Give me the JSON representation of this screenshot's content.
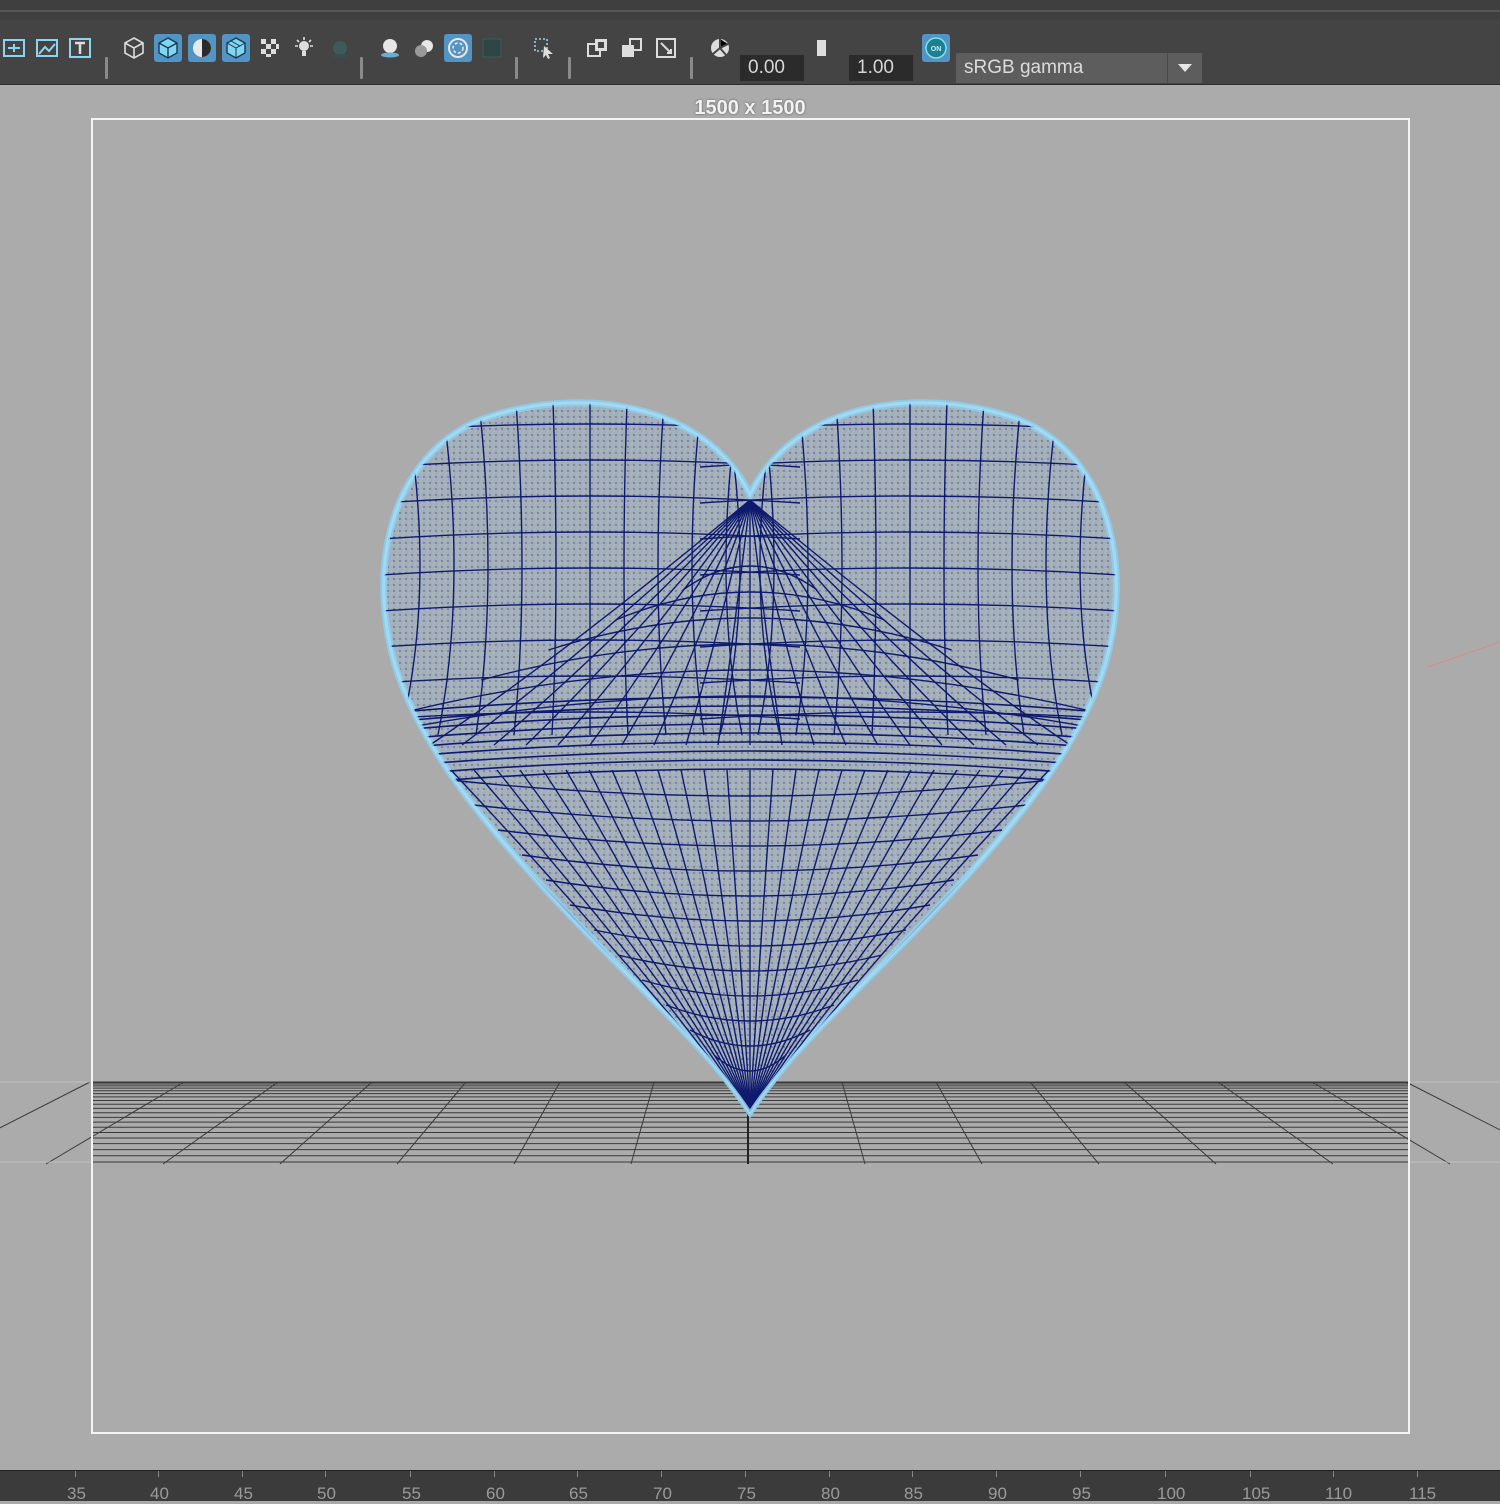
{
  "toolbar": {
    "icons": [
      {
        "name": "frame-all-icon",
        "active": false
      },
      {
        "name": "image-plane-icon",
        "active": false
      },
      {
        "name": "text-icon",
        "active": false
      },
      {
        "name": "wireframe-cube-icon",
        "active": false
      },
      {
        "name": "smooth-shade-cube-icon",
        "active": true
      },
      {
        "name": "shade-half-icon",
        "active": true
      },
      {
        "name": "wireframe-on-shaded-icon",
        "active": true
      },
      {
        "name": "checker-texture-icon",
        "active": false
      },
      {
        "name": "light-icon",
        "active": false
      },
      {
        "name": "shadow-icon",
        "active": false
      },
      {
        "name": "screen-space-ao-icon",
        "active": false
      },
      {
        "name": "motion-blur-icon",
        "active": false
      },
      {
        "name": "anti-aliasing-icon",
        "active": true
      },
      {
        "name": "depth-of-field-icon",
        "active": false
      },
      {
        "name": "select-camera-icon",
        "active": false
      },
      {
        "name": "isolate-select-icon",
        "active": false
      },
      {
        "name": "xray-icon",
        "active": false
      },
      {
        "name": "xray-joints-icon",
        "active": false
      },
      {
        "name": "exposure-icon",
        "active": false
      },
      {
        "name": "gamma-icon",
        "active": false
      },
      {
        "name": "color-management-icon",
        "active": true
      }
    ],
    "exposure_value": "0.00",
    "gamma_value": "1.00",
    "view_transform": "sRGB gamma"
  },
  "viewport": {
    "resolution_label": "1500 x 1500"
  },
  "timeline": {
    "ticks": [
      "35",
      "40",
      "45",
      "50",
      "55",
      "60",
      "65",
      "70",
      "75",
      "80",
      "85",
      "90",
      "95",
      "100",
      "105",
      "110",
      "115"
    ]
  },
  "colors": {
    "active_icon_bg": "#5294c4",
    "wireframe": "#0f1a6e",
    "mesh_shell": "#9fd4ee",
    "viewport_bg": "#ababab"
  }
}
